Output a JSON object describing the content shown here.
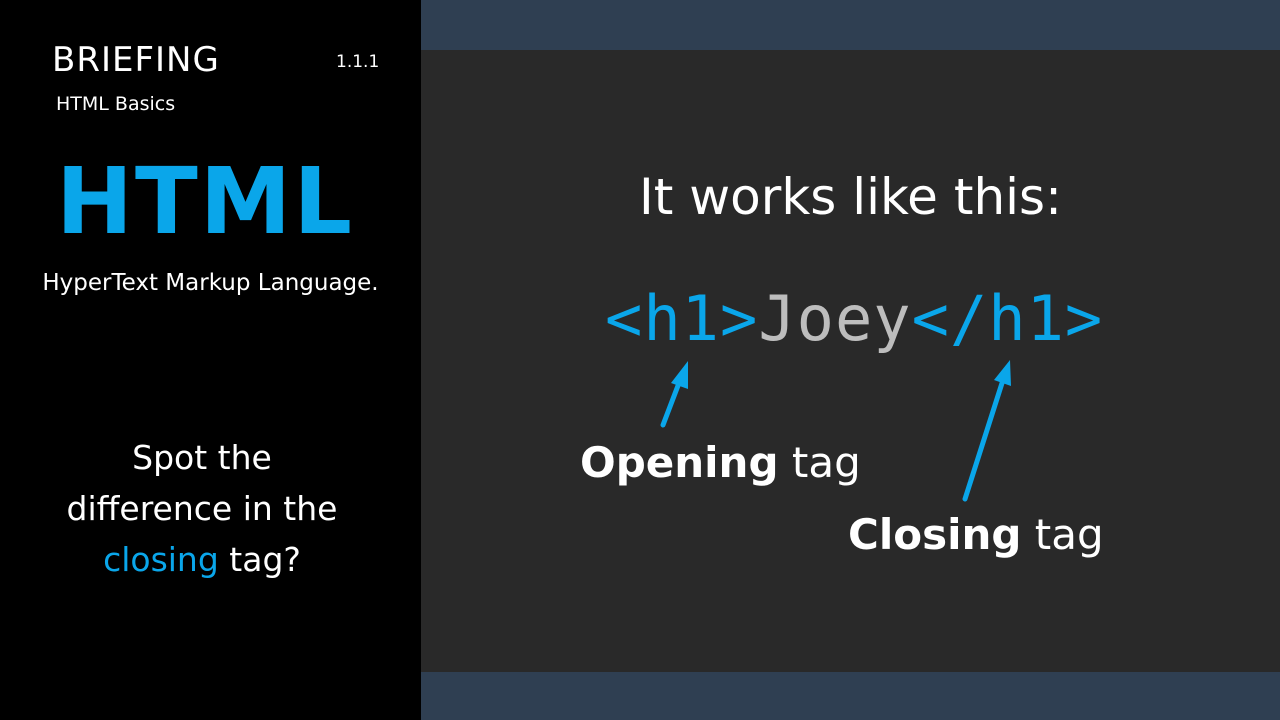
{
  "sidebar": {
    "section": "BRIEFING",
    "version": "1.1.1",
    "subtitle": "HTML Basics",
    "title": "HTML",
    "expansion": "HyperText Markup Language.",
    "question": {
      "line1": "Spot the",
      "line2": "difference in the",
      "highlight": "closing",
      "line3_rest": " tag?"
    }
  },
  "main": {
    "heading": "It works like this:",
    "code": {
      "open_tag": "<h1>",
      "content": "Joey",
      "close_tag": "</h1>"
    },
    "opening_label": {
      "bold": "Opening",
      "rest": " tag"
    },
    "closing_label": {
      "bold": "Closing",
      "rest": " tag"
    }
  },
  "colors": {
    "accent": "#0aa6ea",
    "band": "#2f3f52",
    "slide_bg": "#292929",
    "sidebar_bg": "#000000"
  }
}
